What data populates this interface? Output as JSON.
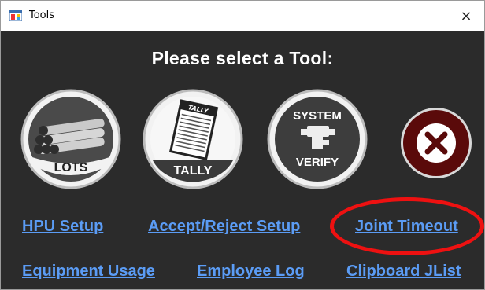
{
  "window": {
    "title": "Tools",
    "close_glyph": "×"
  },
  "heading": "Please select a Tool:",
  "tools": [
    {
      "label": "LOTS",
      "icon": "pipes-icon"
    },
    {
      "label": "TALLY",
      "icon": "tally-sheet-icon"
    },
    {
      "label_top": "SYSTEM",
      "label_bottom": "VERIFY",
      "icon": "system-verify-icon"
    },
    {
      "icon": "close-x-icon"
    }
  ],
  "tally_sheet_header": "TALLY",
  "links": {
    "hpu_setup": "HPU Setup",
    "accept_reject_setup": "Accept/Reject Setup",
    "joint_timeout": "Joint Timeout",
    "equipment_usage": "Equipment Usage",
    "employee_log": "Employee Log",
    "clipboard_jlist": "Clipboard JList"
  },
  "colors": {
    "background": "#2b2b2b",
    "link": "#5b9cf5",
    "highlight": "#ee1111",
    "exit_button": "#5a0a0a"
  }
}
